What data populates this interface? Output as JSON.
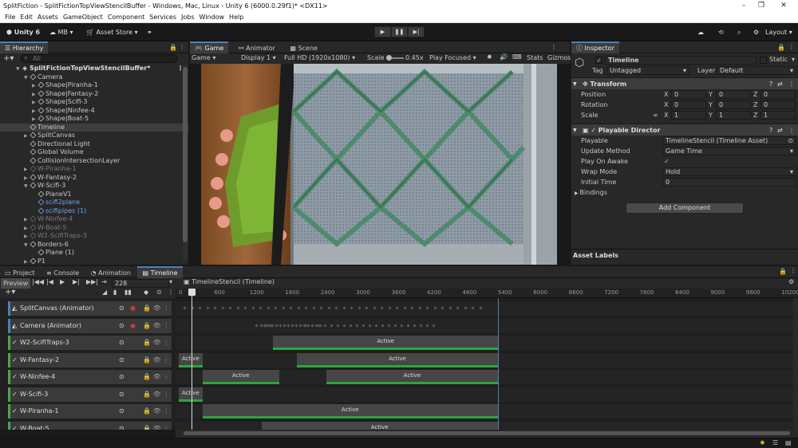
{
  "window": {
    "title": "SplitFiction - SplitFictionTopViewStencilBuffer - Windows, Mac, Linux - Unity 6 (6000.0.29f1)* <DX11>",
    "min": "–",
    "max": "❐",
    "close": "✕"
  },
  "menu": [
    "File",
    "Edit",
    "Assets",
    "GameObject",
    "Component",
    "Services",
    "Jobs",
    "Window",
    "Help"
  ],
  "toolbar": {
    "unity": "Unity 6",
    "account": "MB",
    "asset_store": "Asset Store",
    "layout": "Layout",
    "play": "▶",
    "pause": "❚❚",
    "step": "▶|"
  },
  "hierarchy": {
    "tab": "Hierarchy",
    "search_placeholder": "All",
    "scene": "SplitFictionTopViewStencilBuffer*",
    "rows": [
      {
        "label": "Camera",
        "indent": 1,
        "arrow": "▼",
        "style": ""
      },
      {
        "label": "Shape|Piranha-1",
        "indent": 2,
        "arrow": "▶",
        "style": ""
      },
      {
        "label": "Shape|Fantasy-2",
        "indent": 2,
        "arrow": "▶",
        "style": ""
      },
      {
        "label": "Shape|Scifi-3",
        "indent": 2,
        "arrow": "▶",
        "style": ""
      },
      {
        "label": "Shape|Ninfee-4",
        "indent": 2,
        "arrow": "▶",
        "style": ""
      },
      {
        "label": "Shape|Boat-5",
        "indent": 2,
        "arrow": "▶",
        "style": ""
      },
      {
        "label": "Timeline",
        "indent": 1,
        "arrow": "",
        "style": "sel"
      },
      {
        "label": "SplitCanvas",
        "indent": 1,
        "arrow": "▶",
        "style": ""
      },
      {
        "label": "Directional Light",
        "indent": 1,
        "arrow": "",
        "style": ""
      },
      {
        "label": "Global Volume",
        "indent": 1,
        "arrow": "",
        "style": ""
      },
      {
        "label": "CollisionIntersectionLayer",
        "indent": 1,
        "arrow": "",
        "style": ""
      },
      {
        "label": "W-Piranha-1",
        "indent": 1,
        "arrow": "▶",
        "style": "dim"
      },
      {
        "label": "W-Fantasy-2",
        "indent": 1,
        "arrow": "▶",
        "style": ""
      },
      {
        "label": "W-Scifi-3",
        "indent": 1,
        "arrow": "▼",
        "style": ""
      },
      {
        "label": "PlaneV1",
        "indent": 2,
        "arrow": "",
        "style": ""
      },
      {
        "label": "scifi2plane",
        "indent": 2,
        "arrow": "",
        "style": "blue"
      },
      {
        "label": "scifipipes (1)",
        "indent": 2,
        "arrow": "",
        "style": "blue"
      },
      {
        "label": "W-Ninfee-4",
        "indent": 1,
        "arrow": "▶",
        "style": "dim"
      },
      {
        "label": "W-Boat-5",
        "indent": 1,
        "arrow": "▶",
        "style": "dim"
      },
      {
        "label": "W2-ScifiTraps-3",
        "indent": 1,
        "arrow": "▶",
        "style": "dim"
      },
      {
        "label": "Borders-6",
        "indent": 1,
        "arrow": "▼",
        "style": ""
      },
      {
        "label": "Plane (1)",
        "indent": 2,
        "arrow": "",
        "style": ""
      },
      {
        "label": "P1",
        "indent": 1,
        "arrow": "▶",
        "style": ""
      }
    ]
  },
  "game": {
    "tabs": [
      "Game",
      "Animator",
      "Scene"
    ],
    "display_mode": "Game",
    "display": "Display 1",
    "resolution": "Full HD (1920x1080)",
    "scale_label": "Scale",
    "scale_value": "0.45x",
    "play_mode": "Play Focused",
    "stats": "Stats",
    "gizmos": "Gizmos"
  },
  "inspector": {
    "tab": "Inspector",
    "object_name": "Timeline",
    "static_label": "Static",
    "tag_label": "Tag",
    "tag_value": "Untagged",
    "layer_label": "Layer",
    "layer_value": "Default",
    "transform": {
      "title": "Transform",
      "position": "Position",
      "rotation": "Rotation",
      "scale": "Scale",
      "pos": [
        "0",
        "0",
        "0"
      ],
      "rot": [
        "0",
        "0",
        "0"
      ],
      "scl": [
        "1",
        "1",
        "1"
      ]
    },
    "director": {
      "title": "Playable Director",
      "fields": [
        {
          "label": "Playable",
          "value": "TimelineStencil (Timeline Asset)"
        },
        {
          "label": "Update Method",
          "value": "Game Time"
        },
        {
          "label": "Play On Awake",
          "value": "✓"
        },
        {
          "label": "Wrap Mode",
          "value": "Hold"
        },
        {
          "label": "Initial Time",
          "value": "0"
        }
      ],
      "bindings": "Bindings"
    },
    "add_component": "Add Component",
    "asset_labels": "Asset Labels"
  },
  "bottom": {
    "tabs": [
      "Project",
      "Console",
      "Animation",
      "Timeline"
    ]
  },
  "timeline": {
    "preview": "Preview",
    "frame": "228",
    "asset": "TimelineStencil (Timeline)",
    "ruler": [
      "0",
      "600",
      "1200",
      "1800",
      "2400",
      "3000",
      "3600",
      "4200",
      "4800",
      "5400",
      "6000",
      "6600",
      "7200",
      "7800",
      "8400",
      "9000",
      "9600",
      "10200"
    ],
    "tracks": [
      {
        "name": "SplitCanvas (Animator)",
        "kind": "anim",
        "clips": []
      },
      {
        "name": "Camera (Animator)",
        "kind": "anim",
        "clips": []
      },
      {
        "name": "W2-ScifiTraps-3",
        "kind": "act",
        "clips": [
          {
            "label": "Active",
            "start": 1600,
            "end": 5400
          }
        ]
      },
      {
        "name": "W-Fantasy-2",
        "kind": "act",
        "clips": [
          {
            "label": "Active",
            "start": 0,
            "end": 400
          },
          {
            "label": "Active",
            "start": 2000,
            "end": 5400
          }
        ]
      },
      {
        "name": "W-Ninfee-4",
        "kind": "act",
        "clips": [
          {
            "label": "Active",
            "start": 400,
            "end": 1700
          },
          {
            "label": "Active",
            "start": 2500,
            "end": 5400
          }
        ]
      },
      {
        "name": "W-Scifi-3",
        "kind": "act",
        "clips": [
          {
            "label": "Active",
            "start": 0,
            "end": 400
          }
        ]
      },
      {
        "name": "W-Piranha-1",
        "kind": "act",
        "clips": [
          {
            "label": "Active",
            "start": 400,
            "end": 5400
          }
        ]
      },
      {
        "name": "W-Boat-5",
        "kind": "act",
        "clips": [
          {
            "label": "Active",
            "start": 1400,
            "end": 5400
          }
        ]
      }
    ]
  }
}
